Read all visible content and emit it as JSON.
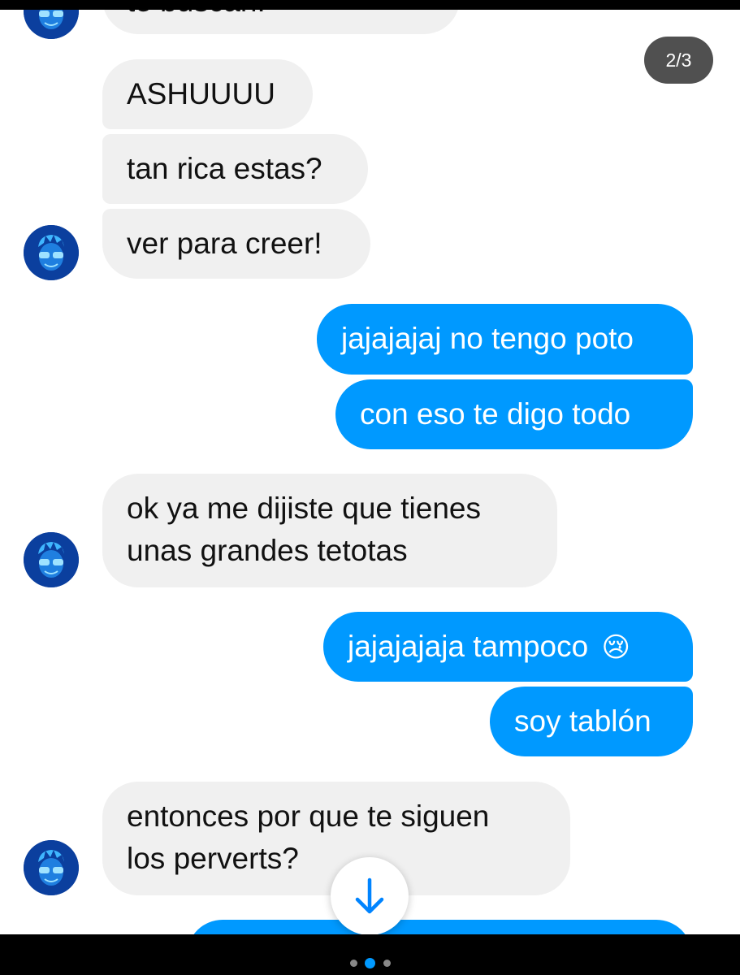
{
  "page_indicator": "2/3",
  "messages": [
    {
      "from": "them",
      "text": "te buscan!"
    },
    {
      "from": "them",
      "text": "ASHUUUU"
    },
    {
      "from": "them",
      "text": "tan rica estas?"
    },
    {
      "from": "them",
      "text": "ver para creer!"
    },
    {
      "from": "me",
      "text": "jajajajaj no tengo poto"
    },
    {
      "from": "me",
      "text": "con eso te digo todo"
    },
    {
      "from": "them",
      "line1": "ok ya me dijiste que tienes",
      "line2": "unas grandes tetotas"
    },
    {
      "from": "me",
      "text": "jajajajaja tampoco",
      "emoji": "😢"
    },
    {
      "from": "me",
      "text": "soy tablón"
    },
    {
      "from": "them",
      "line1": "entonces por que te siguen",
      "line2": "los perverts?"
    },
    {
      "from": "me",
      "text": ""
    }
  ],
  "icons": {
    "avatar": "cartoon-avatar-icon",
    "scroll_down": "arrow-down-icon"
  },
  "carousel": {
    "total": 3,
    "active_index": 1
  },
  "colors": {
    "incoming_bubble": "#f0f0f0",
    "outgoing_bubble": "#0099ff",
    "avatar_bg": "#0b3f9e",
    "page_indicator_bg": "#505050"
  }
}
